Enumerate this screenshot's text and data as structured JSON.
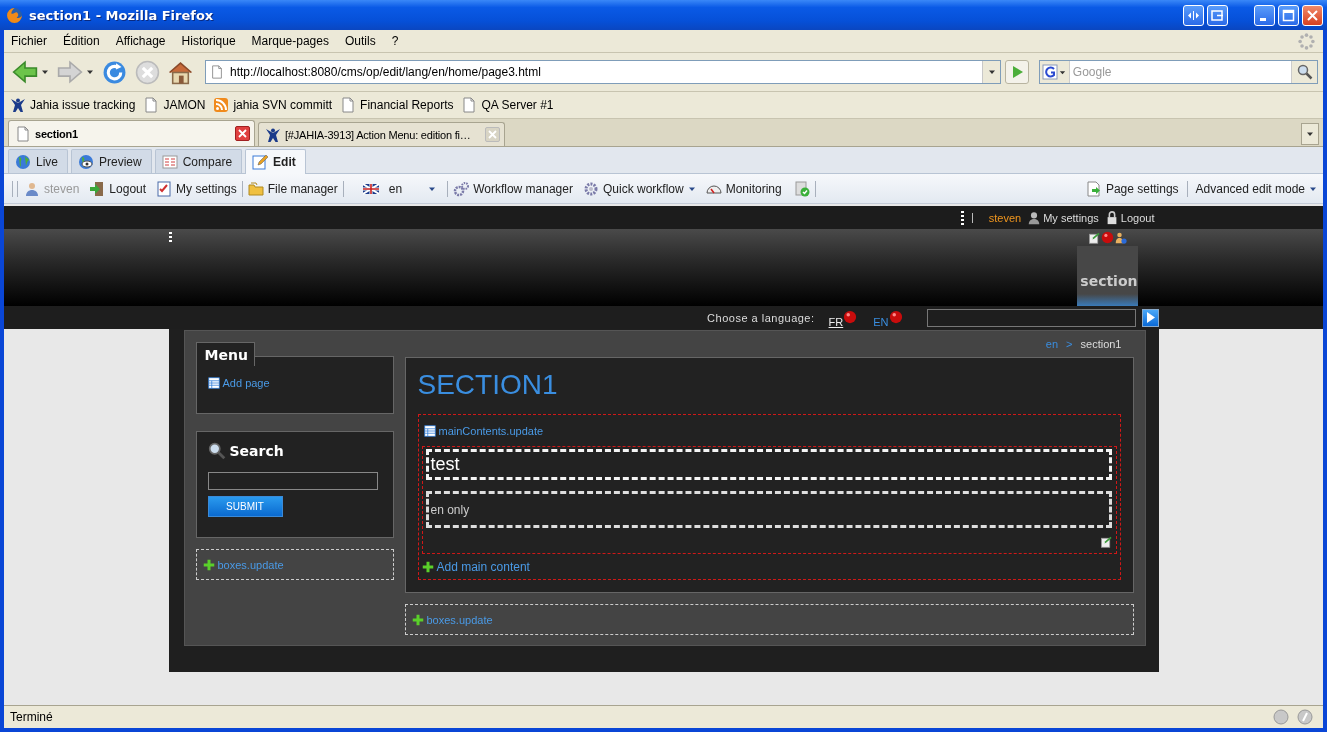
{
  "window": {
    "title": "section1 - Mozilla Firefox"
  },
  "menu": [
    "Fichier",
    "Édition",
    "Affichage",
    "Historique",
    "Marque-pages",
    "Outils",
    "?"
  ],
  "address": {
    "value": "http://localhost:8080/cms/op/edit/lang/en/home/page3.html"
  },
  "search": {
    "placeholder": "Google"
  },
  "bookmarks": [
    {
      "label": "Jahia issue tracking",
      "kind": "jahia"
    },
    {
      "label": "JAMON",
      "kind": "page"
    },
    {
      "label": "jahia SVN committ",
      "kind": "feed"
    },
    {
      "label": "Financial Reports",
      "kind": "page"
    },
    {
      "label": "QA Server #1",
      "kind": "page"
    }
  ],
  "tabs": [
    {
      "label": "section1",
      "kind": "page",
      "selected": true
    },
    {
      "label": "[#JAHIA-3913] Action Menu: edition fi…",
      "kind": "jahia",
      "selected": false
    }
  ],
  "modes": [
    {
      "label": "Live",
      "kind": "live",
      "selected": false
    },
    {
      "label": "Preview",
      "kind": "preview",
      "selected": false
    },
    {
      "label": "Compare",
      "kind": "compare",
      "selected": false
    },
    {
      "label": "Edit",
      "kind": "edit",
      "selected": true
    }
  ],
  "toolbar": {
    "left": [
      [
        {
          "label": "steven",
          "kind": "user",
          "disabled": true
        },
        {
          "label": "Logout",
          "kind": "logout",
          "disabled": false
        },
        {
          "label": "My settings",
          "kind": "settings",
          "disabled": false
        }
      ],
      [
        {
          "label": "File manager",
          "kind": "files",
          "disabled": false
        }
      ],
      [
        {
          "label": "en",
          "kind": "lang",
          "disabled": false
        }
      ],
      [
        {
          "label": "Workflow manager",
          "kind": "workflow",
          "disabled": false
        },
        {
          "label": "Quick workflow",
          "kind": "quick",
          "disabled": false
        },
        {
          "label": "Monitoring",
          "kind": "monitor",
          "disabled": false
        }
      ]
    ],
    "right": [
      {
        "label": "Page settings",
        "kind": "pagesettings",
        "disabled": false
      },
      {
        "label": "Advanced edit mode",
        "kind": "mode",
        "disabled": false
      }
    ]
  },
  "site": {
    "topbar": {
      "user": "steven",
      "links": [
        {
          "label": "My settings",
          "kind": "user"
        },
        {
          "label": "Logout",
          "kind": "lock"
        }
      ]
    },
    "nav": [
      {
        "label": "section",
        "selected": true
      }
    ],
    "language": {
      "label": "Choose a language:",
      "options": [
        {
          "label": "FR",
          "selected": false
        },
        {
          "label": "EN",
          "selected": true
        }
      ]
    },
    "breadcrumb": {
      "items": [
        "en",
        "section1"
      ],
      "separator": ">"
    },
    "menu_box": {
      "title": "Menu",
      "link": "Add page"
    },
    "search_box": {
      "title": "Search",
      "button": "SUBMIT"
    },
    "side_area": "boxes.update",
    "heading": "SECTION1",
    "main_area": {
      "label": "mainContents.update",
      "items": [
        {
          "text": "test",
          "kind": "title"
        },
        {
          "text": "en only",
          "kind": "text"
        }
      ],
      "add": "Add main content"
    },
    "bottom_area": "boxes.update"
  },
  "status_bar": "Terminé"
}
